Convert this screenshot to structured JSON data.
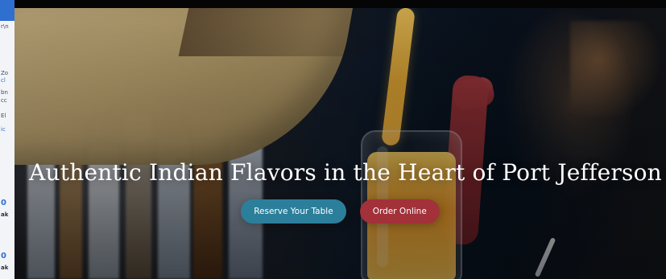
{
  "hero": {
    "headline": "Authentic Indian Flavors in the Heart of Port Jefferson",
    "buttons": {
      "reserve": "Reserve Your Table",
      "order": "Order Online"
    }
  },
  "colors": {
    "reserve_button": "#2b7f9b",
    "order_button": "#a2313a",
    "left_tab_blue": "#2f6fd0"
  },
  "left_panel_fragments": [
    "r\\n",
    "Zo",
    "cl",
    "bn",
    "cc",
    "El",
    "ic",
    "0",
    "ak",
    "0",
    "ak"
  ]
}
